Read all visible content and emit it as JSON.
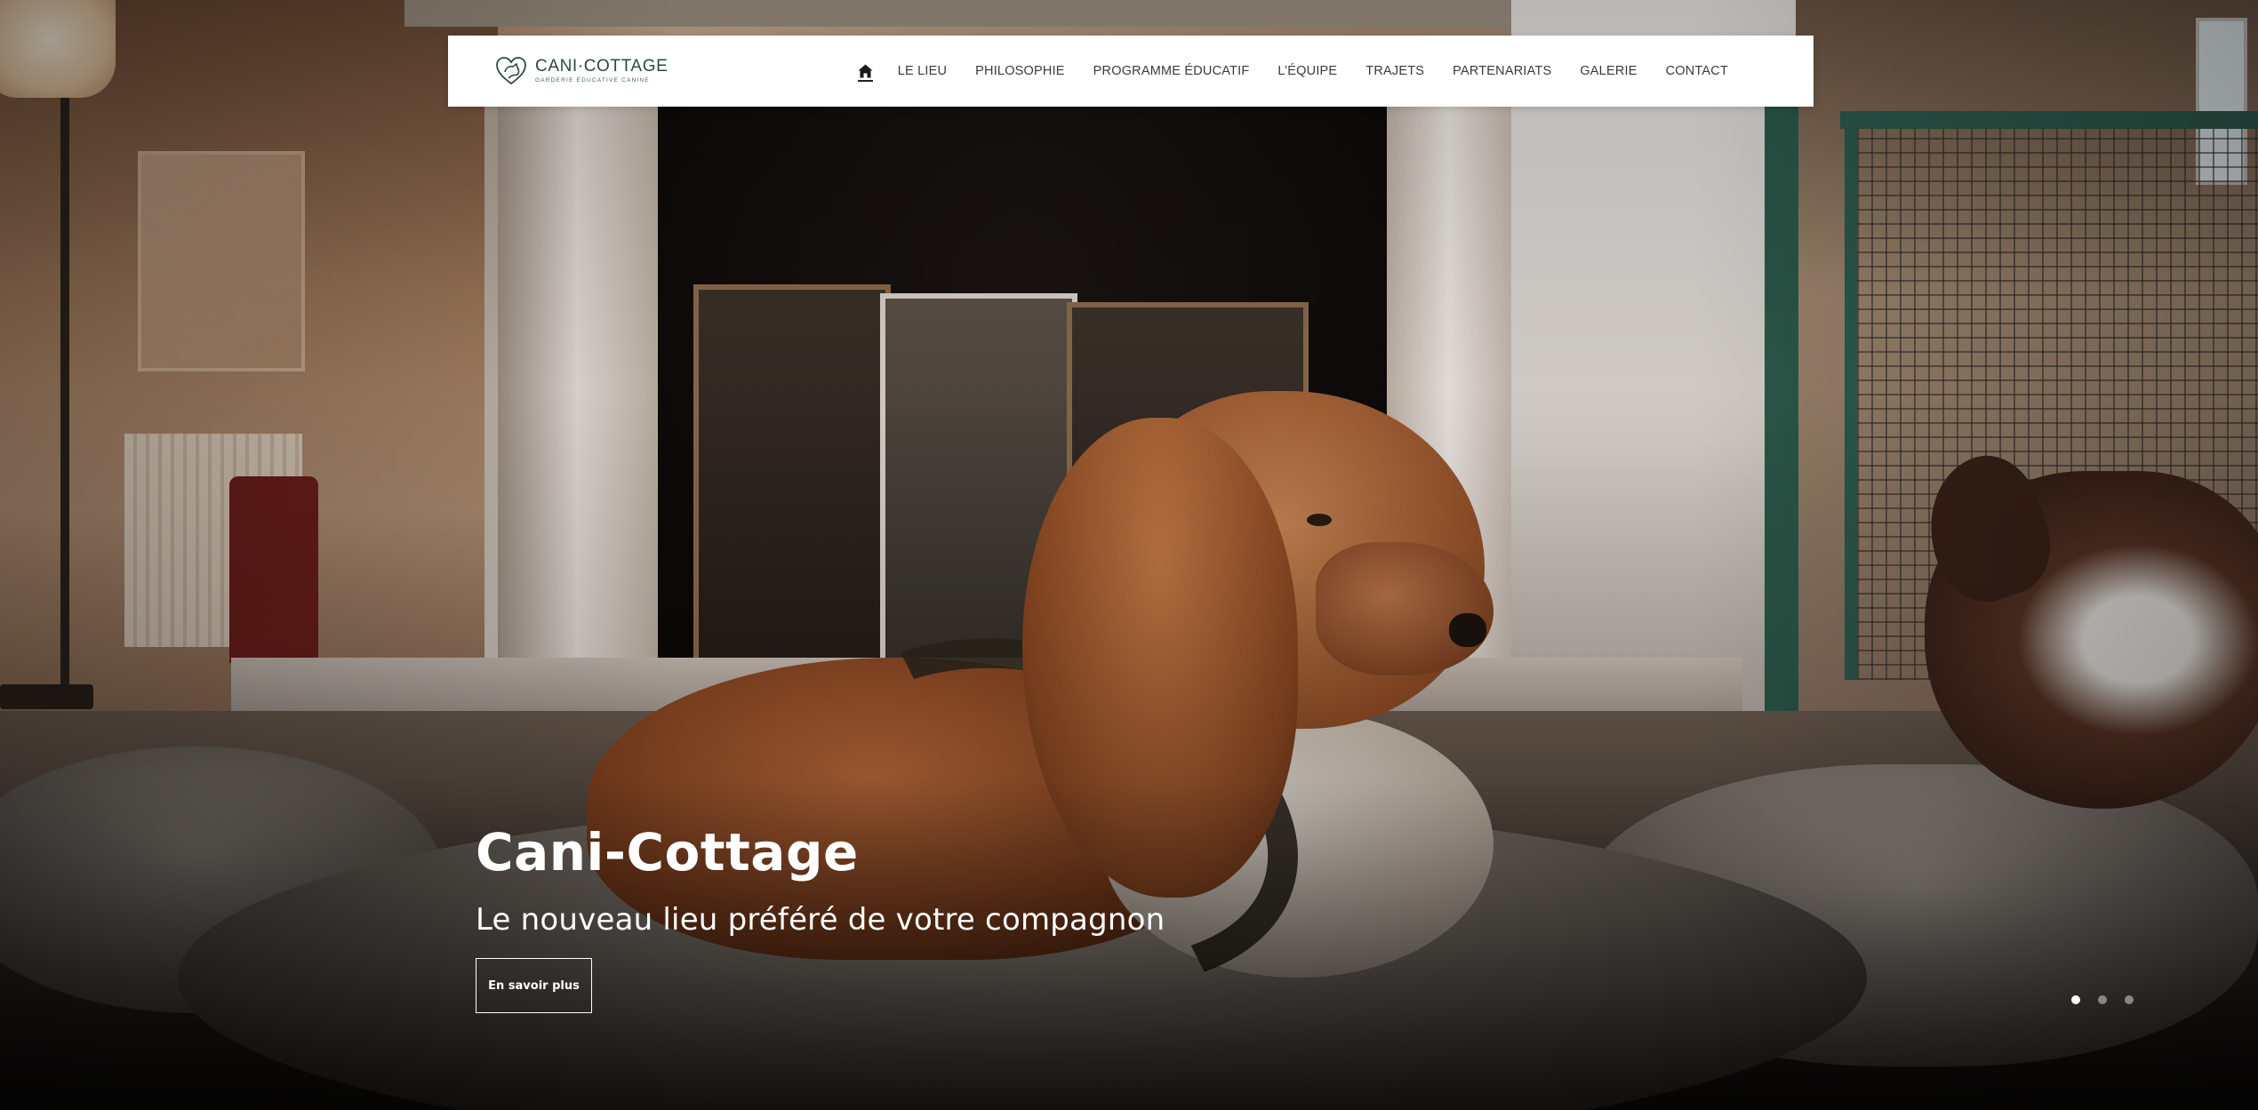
{
  "brand": {
    "name": "CANI·COTTAGE",
    "tagline": "GARDERIE ÉDUCATIVE CANINE",
    "color": "#2a4a3c"
  },
  "nav": {
    "home_icon": "home-icon",
    "items": [
      {
        "label": "LE LIEU"
      },
      {
        "label": "PHILOSOPHIE"
      },
      {
        "label": "PROGRAMME ÉDUCATIF"
      },
      {
        "label": "L’ÉQUIPE"
      },
      {
        "label": "TRAJETS"
      },
      {
        "label": "PARTENARIATS"
      },
      {
        "label": "GALERIE"
      },
      {
        "label": "CONTACT"
      }
    ],
    "active": "home"
  },
  "hero": {
    "title": "Cani-Cottage",
    "subtitle": "Le nouveau lieu préféré de votre compagnon",
    "button_label": "En savoir plus",
    "slides_count": 3,
    "active_slide": 1
  }
}
